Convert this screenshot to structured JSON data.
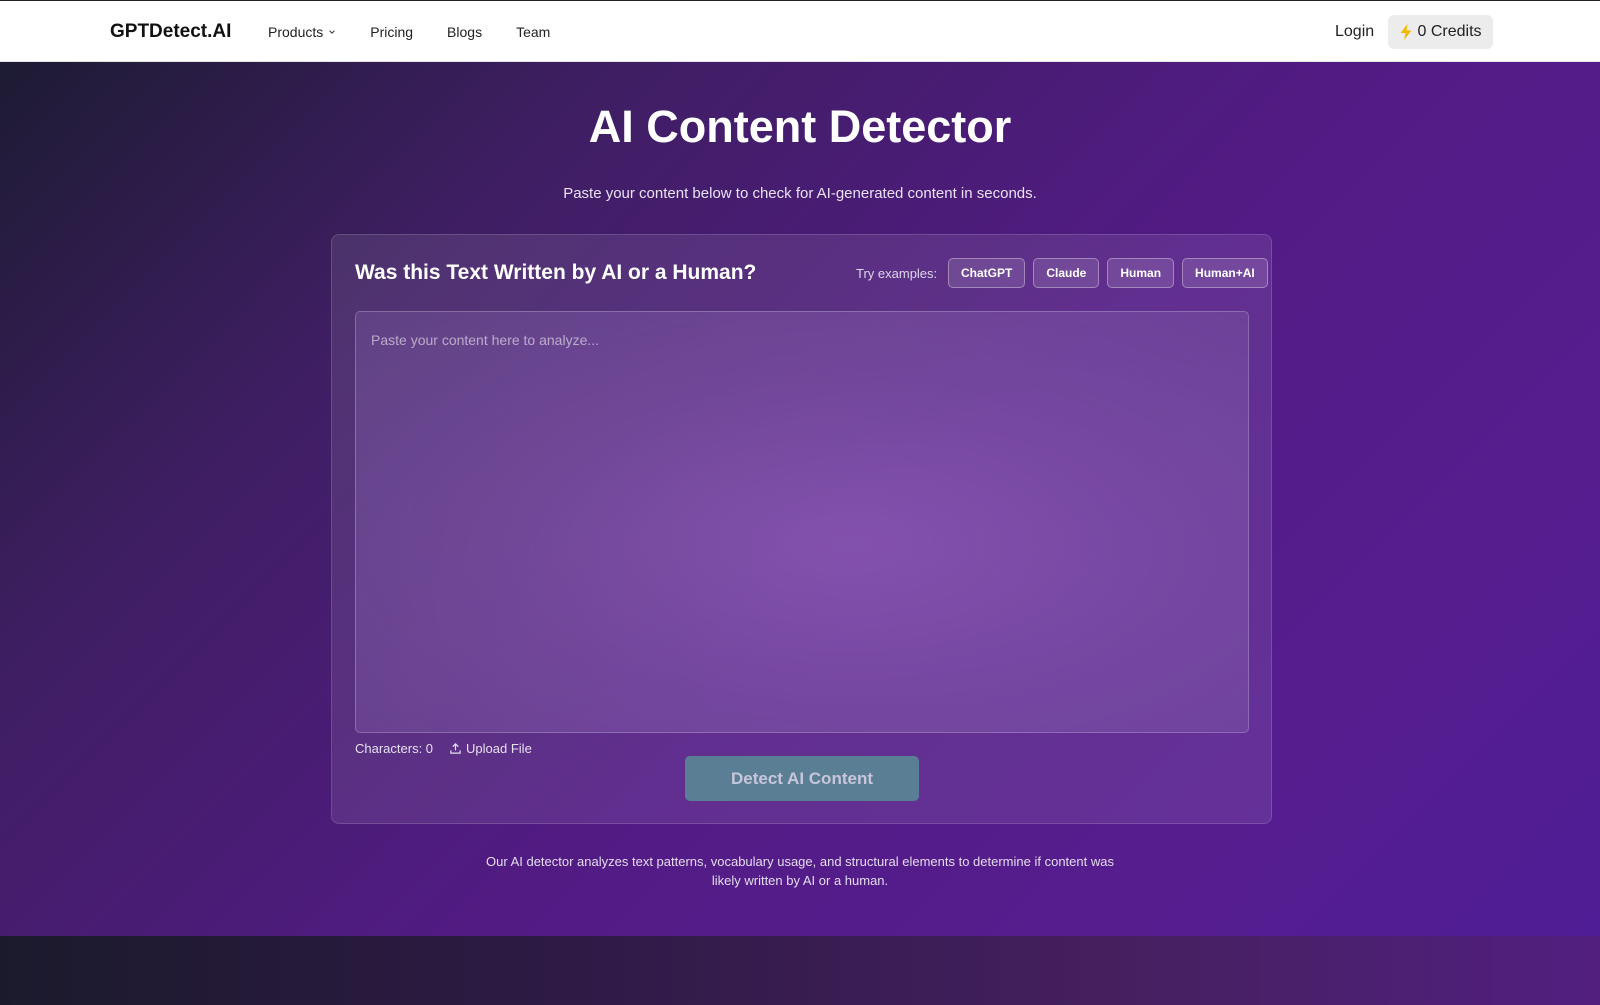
{
  "nav": {
    "logo": "GPTDetect.AI",
    "links": [
      "Products",
      "Pricing",
      "Blogs",
      "Team"
    ],
    "login": "Login",
    "credits": "0 Credits"
  },
  "hero": {
    "title": "AI Content Detector",
    "subtitle": "Paste your content below to check for AI-generated content in seconds."
  },
  "card": {
    "title": "Was this Text Written by AI or a Human?",
    "try_label": "Try examples:",
    "examples": [
      "ChatGPT",
      "Claude",
      "Human",
      "Human+AI"
    ],
    "placeholder": "Paste your content here to analyze...",
    "characters": "Characters: 0",
    "upload": "Upload File",
    "detect": "Detect AI Content"
  },
  "footnote": "Our AI detector analyzes text patterns, vocabulary usage, and structural elements to determine if content was likely written by AI or a human.",
  "colors": {
    "accent_button": "#5a7f95",
    "bolt": "#f5b800",
    "hero_gradient_end": "#521b84"
  }
}
